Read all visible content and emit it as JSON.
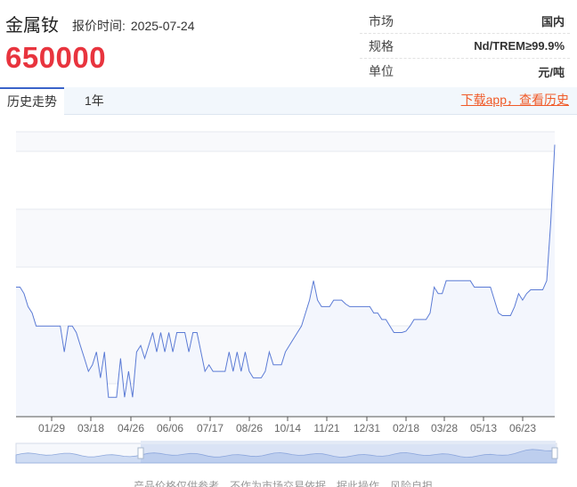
{
  "header": {
    "product_name": "金属钕",
    "quote_time_label": "报价时间:",
    "quote_time": "2025-07-24",
    "price": "650000"
  },
  "spec": [
    {
      "key": "市场",
      "value": "国内"
    },
    {
      "key": "规格",
      "value": "Nd/TREM≥99.9%"
    },
    {
      "key": "单位",
      "value": "元/吨"
    }
  ],
  "tabs": {
    "history": "历史走势",
    "year": "1年",
    "download": "下载app，查看历史"
  },
  "footer": "产品价格仅供参考，不作为市场交易依据，据此操作，风险自担。",
  "colors": {
    "line": "#5b7bd5",
    "price": "#e8343e",
    "link": "#f05a28"
  },
  "chart_data": {
    "type": "line",
    "x_ticks": [
      "01/29",
      "03/18",
      "04/26",
      "06/06",
      "07/17",
      "08/26",
      "10/14",
      "11/21",
      "12/31",
      "02/18",
      "03/28",
      "05/13",
      "06/23"
    ],
    "grid": true,
    "ylim": [
      440000,
      660000
    ],
    "series": [
      {
        "values": [
          540000,
          540000,
          535000,
          525000,
          520000,
          510000,
          510000,
          510000,
          510000,
          510000,
          510000,
          510000,
          490000,
          510000,
          510000,
          505000,
          495000,
          485000,
          475000,
          480000,
          490000,
          470000,
          490000,
          455000,
          455000,
          455000,
          485000,
          455000,
          475000,
          455000,
          490000,
          495000,
          485000,
          495000,
          505000,
          490000,
          505000,
          490000,
          505000,
          490000,
          505000,
          505000,
          505000,
          490000,
          505000,
          505000,
          490000,
          475000,
          480000,
          475000,
          475000,
          475000,
          475000,
          490000,
          475000,
          490000,
          475000,
          490000,
          475000,
          470000,
          470000,
          470000,
          475000,
          490000,
          480000,
          480000,
          480000,
          490000,
          495000,
          500000,
          505000,
          510000,
          520000,
          530000,
          545000,
          530000,
          525000,
          525000,
          525000,
          530000,
          530000,
          530000,
          527000,
          525000,
          525000,
          525000,
          525000,
          525000,
          525000,
          520000,
          520000,
          515000,
          515000,
          510000,
          505000,
          505000,
          505000,
          506000,
          510000,
          515000,
          515000,
          515000,
          515000,
          520000,
          540000,
          535000,
          535000,
          545000,
          545000,
          545000,
          545000,
          545000,
          545000,
          545000,
          540000,
          540000,
          540000,
          540000,
          540000,
          530000,
          520000,
          518000,
          518000,
          518000,
          525000,
          535000,
          530000,
          535000,
          538000,
          538000,
          538000,
          538000,
          545000,
          590000,
          650000
        ]
      }
    ]
  }
}
